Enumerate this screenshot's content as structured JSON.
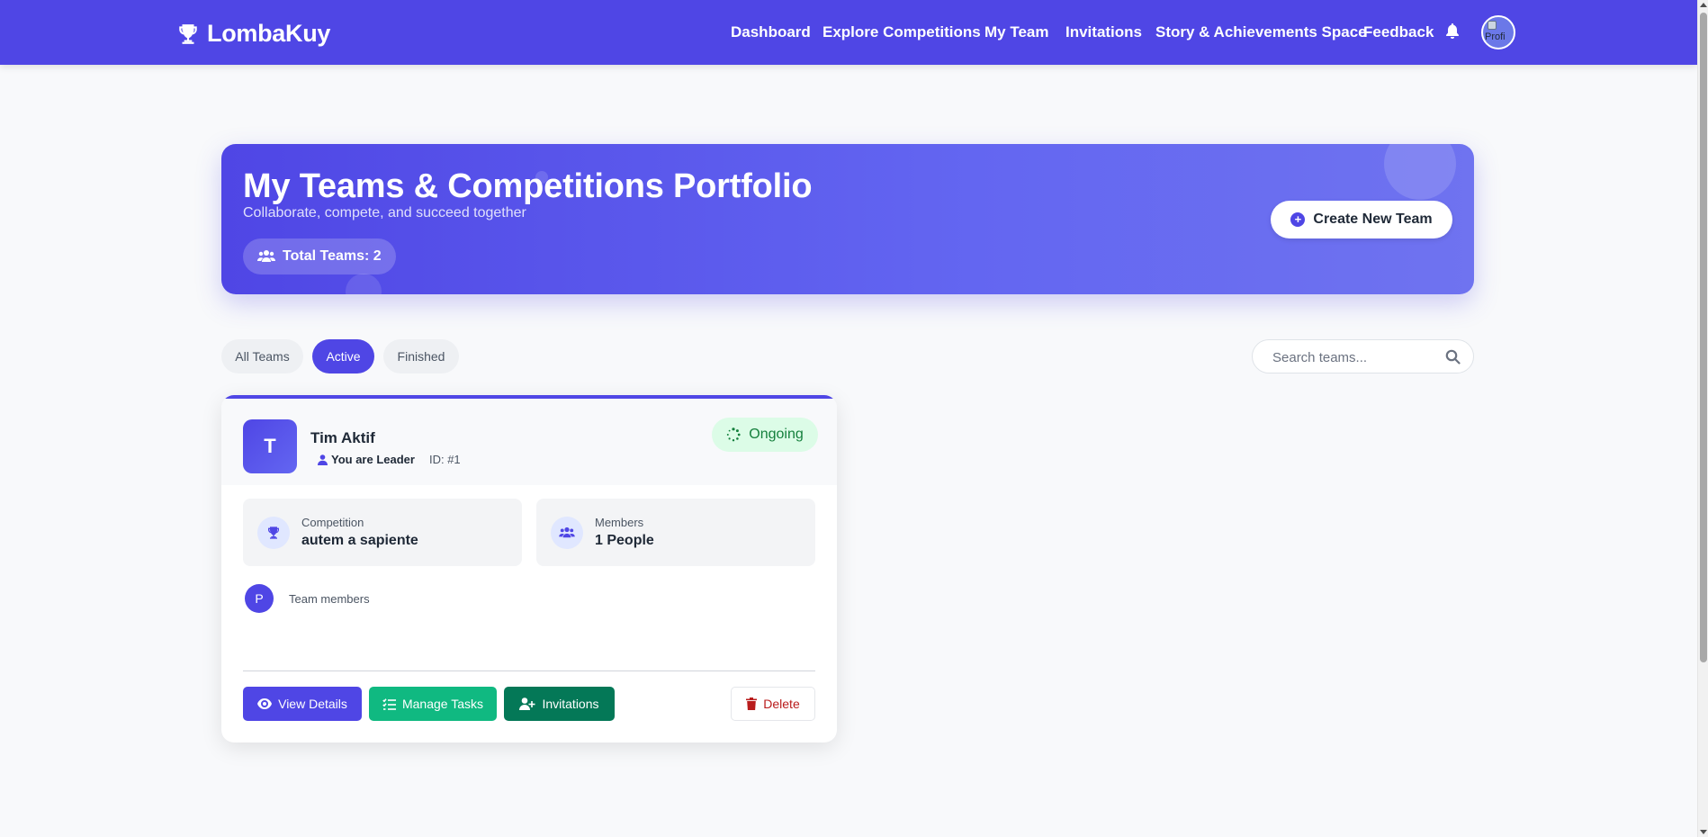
{
  "navbar": {
    "brand": "LombaKuy",
    "links": [
      "Dashboard",
      "Explore Competitions",
      "My Team",
      "Invitations",
      "Story & Achievements Space",
      "Feedback"
    ],
    "avatar_alt": "Profi",
    "colors": {
      "primary": "#4f46e5"
    }
  },
  "hero": {
    "title": "My Teams & Competitions Portfolio",
    "subtitle": "Collaborate, compete, and succeed together",
    "badge": "Total Teams: 2",
    "create_button": "Create New Team"
  },
  "filters": {
    "items": [
      {
        "label": "All Teams",
        "active": false
      },
      {
        "label": "Active",
        "active": true
      },
      {
        "label": "Finished",
        "active": false
      }
    ],
    "search_placeholder": "Search teams..."
  },
  "team_card": {
    "avatar_letter": "T",
    "name": "Tim Aktif",
    "role": "You are Leader",
    "id_text": "ID: #1",
    "status": "Ongoing",
    "competition": {
      "label": "Competition",
      "value": "autem a sapiente"
    },
    "members": {
      "label": "Members",
      "value": "1 People"
    },
    "member_initial": "P",
    "members_caption": "Team members",
    "actions": {
      "view": "View Details",
      "tasks": "Manage Tasks",
      "invitations": "Invitations",
      "delete": "Delete"
    },
    "colors": {
      "status_bg": "#dcfce7",
      "status_text": "#15803d",
      "tasks_btn": "#10b981",
      "invitations_btn": "#047857",
      "delete_text": "#b91c1c"
    }
  }
}
